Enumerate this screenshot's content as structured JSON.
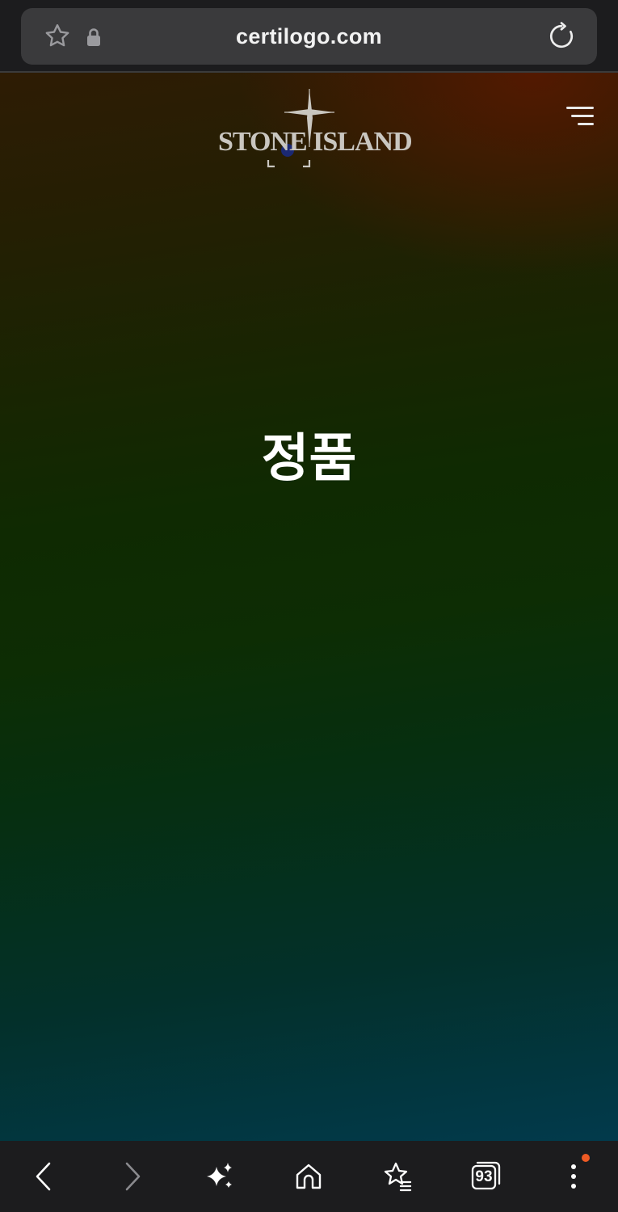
{
  "browser": {
    "url": "certilogo.com",
    "icons": {
      "favorite": "star-outline-icon",
      "security": "lock-icon",
      "reload": "reload-icon"
    }
  },
  "site": {
    "logo_text": "STONE ISLAND",
    "headline": "정품",
    "menu_icon": "hamburger-menu-icon"
  },
  "bottom_nav": {
    "back_icon": "chevron-left-icon",
    "forward_icon": "chevron-right-icon",
    "ai_icon": "sparkles-icon",
    "home_icon": "home-icon",
    "bookmarks_icon": "star-list-icon",
    "tab_count": "93",
    "more_icon": "vertical-dots-icon",
    "notification_color": "#ee5a24"
  },
  "colors": {
    "page_top": "#2e1c04",
    "page_middle": "#0d2d04",
    "page_bottom": "#023a4c",
    "chrome": "#1c1c1e"
  }
}
